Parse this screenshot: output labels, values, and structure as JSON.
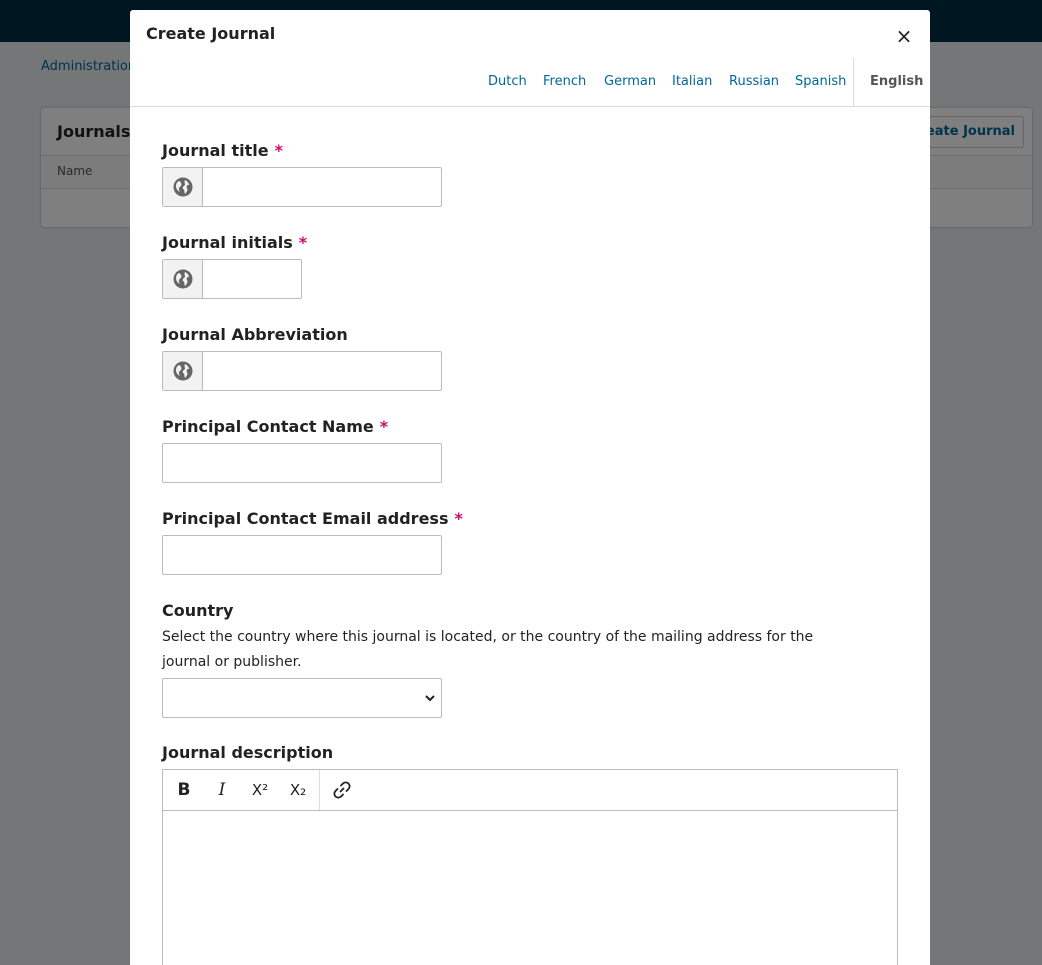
{
  "background": {
    "breadcrumb": "Administration",
    "panel_title": "Journals",
    "column_name": "Name",
    "create_button": "reate Journal"
  },
  "modal": {
    "title": "Create Journal",
    "close_symbol": "×",
    "locales": [
      "Dutch",
      "French",
      "German",
      "Italian",
      "Russian",
      "Spanish"
    ],
    "current_locale": "English",
    "required_marker": "*",
    "fields": {
      "journal_title": "Journal title",
      "journal_initials": "Journal initials",
      "journal_abbreviation": "Journal Abbreviation",
      "contact_name": "Principal Contact Name",
      "contact_email": "Principal Contact Email address",
      "country": "Country",
      "country_description": "Select the country where this journal is located, or the country of the mailing address for the journal or publisher.",
      "description": "Journal description"
    },
    "toolbar": {
      "bold": "B",
      "italic": "I",
      "superscript": "X²",
      "subscript": "X₂"
    }
  },
  "colors": {
    "accent": "#006798",
    "required": "#d00a6c",
    "header": "#002c40"
  }
}
